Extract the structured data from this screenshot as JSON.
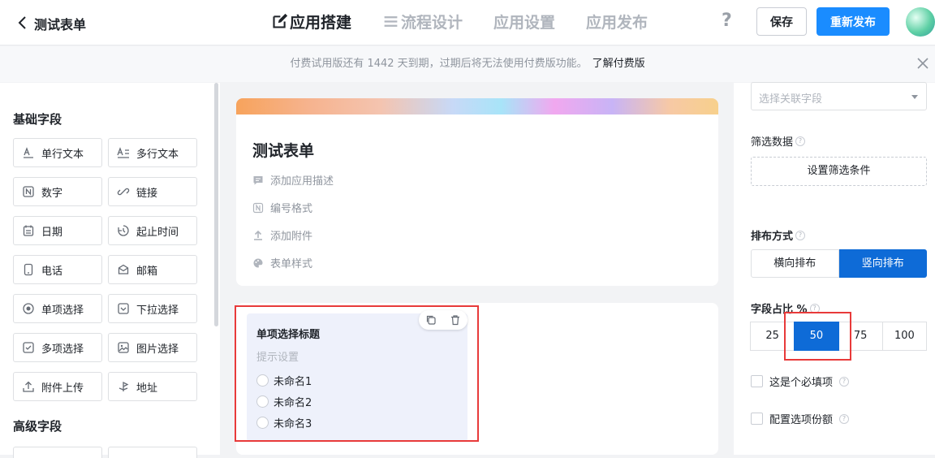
{
  "header": {
    "title": "测试表单",
    "tabs": [
      {
        "label": "应用搭建",
        "icon": "edit-icon",
        "active": true
      },
      {
        "label": "流程设计",
        "icon": "list-icon",
        "active": false
      },
      {
        "label": "应用设置",
        "active": false
      },
      {
        "label": "应用发布",
        "active": false
      }
    ],
    "help": "?",
    "save_label": "保存",
    "publish_label": "重新发布"
  },
  "notice": {
    "text": "付费试用版还有 1442 天到期，过期后将无法使用付费版功能。",
    "link": "了解付费版"
  },
  "sidebar": {
    "basic_title": "基础字段",
    "advanced_title": "高级字段",
    "fields": [
      {
        "label": "单行文本",
        "icon": "single-line-text-icon"
      },
      {
        "label": "多行文本",
        "icon": "multi-line-text-icon"
      },
      {
        "label": "数字",
        "icon": "number-icon"
      },
      {
        "label": "链接",
        "icon": "link-icon"
      },
      {
        "label": "日期",
        "icon": "calendar-icon"
      },
      {
        "label": "起止时间",
        "icon": "time-range-icon"
      },
      {
        "label": "电话",
        "icon": "phone-icon"
      },
      {
        "label": "邮箱",
        "icon": "mail-icon"
      },
      {
        "label": "单项选择",
        "icon": "radio-icon"
      },
      {
        "label": "下拉选择",
        "icon": "dropdown-icon"
      },
      {
        "label": "多项选择",
        "icon": "checkbox-icon"
      },
      {
        "label": "图片选择",
        "icon": "image-icon"
      },
      {
        "label": "附件上传",
        "icon": "upload-icon"
      },
      {
        "label": "地址",
        "icon": "location-icon"
      }
    ]
  },
  "form": {
    "title": "测试表单",
    "options": [
      {
        "label": "添加应用描述",
        "icon": "comment-icon"
      },
      {
        "label": "编号格式",
        "icon": "number-format-icon"
      },
      {
        "label": "添加附件",
        "icon": "upload-icon"
      },
      {
        "label": "表单样式",
        "icon": "palette-icon"
      }
    ]
  },
  "question": {
    "title": "单项选择标题",
    "hint": "提示设置",
    "options": [
      "未命名1",
      "未命名2",
      "未命名3"
    ]
  },
  "panel": {
    "select_placeholder": "选择关联字段",
    "filter_label": "筛选数据",
    "filter_button": "设置筛选条件",
    "layout_label": "排布方式",
    "layout_options": [
      "横向排布",
      "竖向排布"
    ],
    "layout_selected": "竖向排布",
    "ratio_label": "字段占比 %",
    "ratio_options": [
      "25",
      "50",
      "75",
      "100"
    ],
    "ratio_selected": "50",
    "required_label": "这是个必填项",
    "quota_label": "配置选项份额"
  },
  "colors": {
    "accent": "#1a8cff",
    "selected": "#0e6bd7",
    "highlight": "#e83a3a"
  }
}
